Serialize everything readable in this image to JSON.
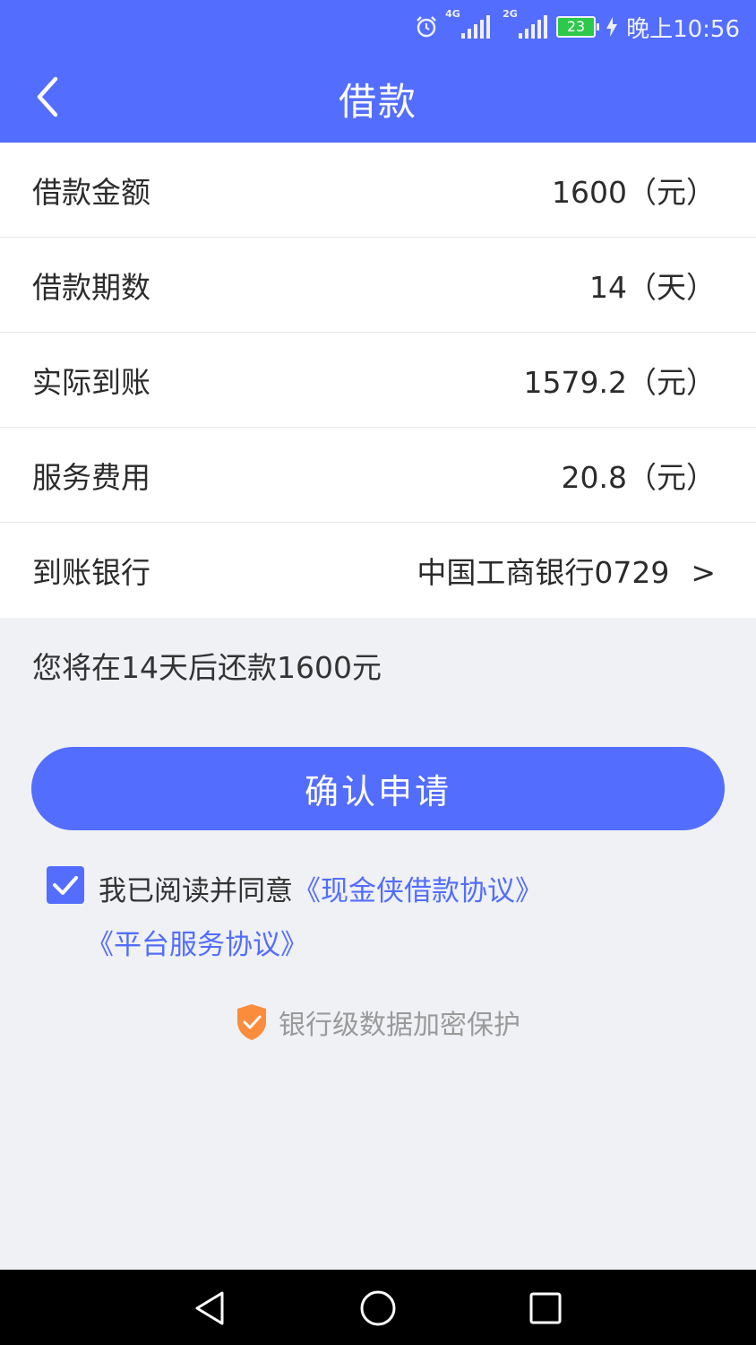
{
  "status_bar": {
    "network_1": "4G",
    "network_2": "2G",
    "battery": "23",
    "time": "晚上10:56",
    "icons": [
      "alarm-icon",
      "signal-icon",
      "signal-icon",
      "battery-icon",
      "charging-icon"
    ]
  },
  "header": {
    "title": "借款",
    "back_icon": "chevron-left-icon"
  },
  "details": [
    {
      "label": "借款金额",
      "value": "1600（元）"
    },
    {
      "label": "借款期数",
      "value": "14（天）"
    },
    {
      "label": "实际到账",
      "value": "1579.2（元）"
    },
    {
      "label": "服务费用",
      "value": "20.8（元）"
    },
    {
      "label": "到账银行",
      "value": "中国工商银行0729",
      "chevron": ">"
    }
  ],
  "notice": "您将在14天后还款1600元",
  "confirm_button": "确认申请",
  "agreement": {
    "checked": true,
    "prefix": "我已阅读并同意",
    "link_loan": "《现金侠借款协议》",
    "link_platform": "《平台服务协议》"
  },
  "security_text": "银行级数据加密保护",
  "colors": {
    "primary": "#536dfe",
    "background": "#eff1f5",
    "shield": "#fb8c3c"
  },
  "nav_bar": {
    "icons": [
      "back-triangle-icon",
      "home-circle-icon",
      "recents-square-icon"
    ]
  }
}
